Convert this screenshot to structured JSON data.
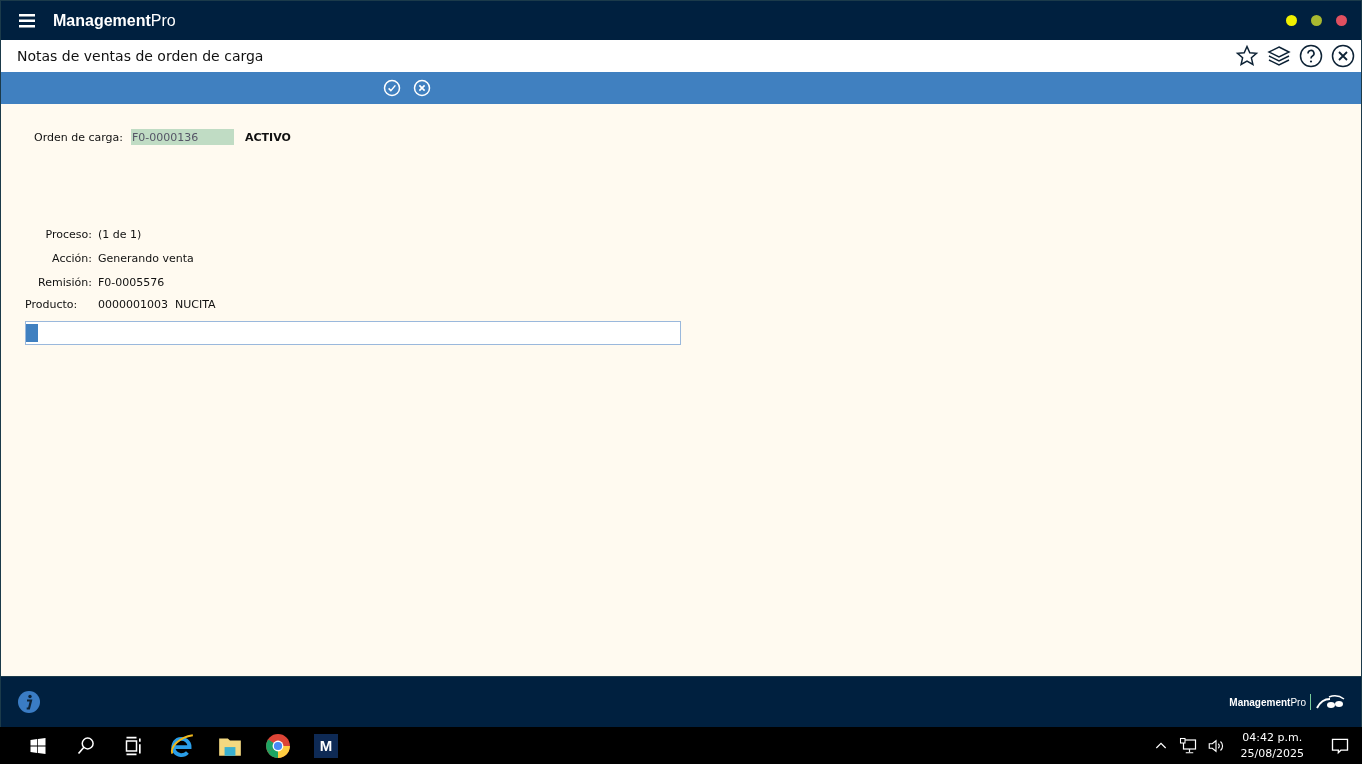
{
  "app": {
    "brand": "**Management**Pro"
  },
  "page": {
    "title": "Notas de ventas de orden de carga"
  },
  "form": {
    "order_label": "Orden de carga:",
    "order_value": "F0-0000136",
    "status": "ACTIVO"
  },
  "process": [
    {
      "label": "Proceso:",
      "value": "(1 de 1)"
    },
    {
      "label": "Acción:",
      "value": "Generando venta"
    },
    {
      "label": "Remisión:",
      "value": "F0-0005576"
    }
  ],
  "product": {
    "label": "Producto:",
    "value": "0000001003  NUCITA"
  },
  "progress": {
    "level": 0.018
  },
  "footer": {
    "brand": "**Management**Pro"
  },
  "taskbar": {
    "app_label": "M",
    "time": "04:42 p.m.",
    "date": "25/08/2025"
  }
}
